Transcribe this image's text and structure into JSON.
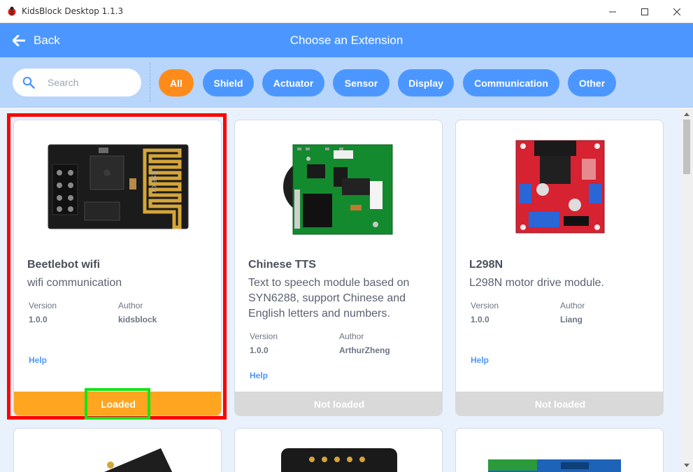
{
  "window": {
    "title": "KidsBlock Desktop 1.1.3",
    "icon": "ladybug-icon",
    "controls": [
      "minimize-icon",
      "maximize-icon",
      "close-icon"
    ]
  },
  "header": {
    "back_label": "Back",
    "title": "Choose an Extension"
  },
  "search": {
    "placeholder": "Search",
    "value": ""
  },
  "filters": [
    {
      "label": "All",
      "active": true
    },
    {
      "label": "Shield",
      "active": false
    },
    {
      "label": "Actuator",
      "active": false
    },
    {
      "label": "Sensor",
      "active": false
    },
    {
      "label": "Display",
      "active": false
    },
    {
      "label": "Communication",
      "active": false
    },
    {
      "label": "Other",
      "active": false
    }
  ],
  "cards": [
    {
      "name": "Beetlebot wifi",
      "description": "wifi communication",
      "version_label": "Version",
      "version": "1.0.0",
      "author_label": "Author",
      "author": "kidsblock",
      "help": "Help",
      "status": "Loaded",
      "image": "esp-01-wifi-module",
      "image_text": "ESP-01"
    },
    {
      "name": "Chinese TTS",
      "description": "Text to speech module based on SYN6288, support Chinese and English letters and numbers.",
      "version_label": "Version",
      "version": "1.0.0",
      "author_label": "Author",
      "author": "ArthurZheng",
      "help": "Help",
      "status": "Not loaded",
      "image": "tts-module-board"
    },
    {
      "name": "L298N",
      "description": "L298N motor drive module.",
      "version_label": "Version",
      "version": "1.0.0",
      "author_label": "Author",
      "author": "Liang",
      "help": "Help",
      "status": "Not loaded",
      "image": "l298n-motor-driver-board"
    }
  ],
  "colors": {
    "header_blue": "#4c97ff",
    "filter_bar": "#b8d5fb",
    "active_chip": "#ff8c1a",
    "loaded": "#ffa51f",
    "not_loaded": "#d9d9d9",
    "highlight_red": "#ff0000",
    "highlight_green": "#15e515"
  }
}
